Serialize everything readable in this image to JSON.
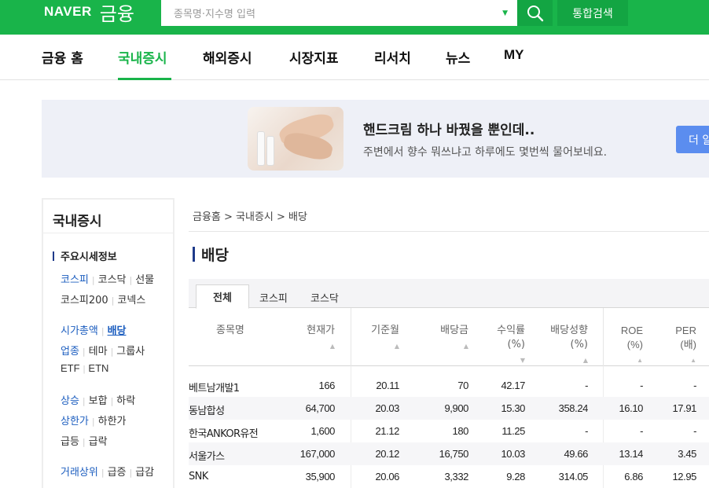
{
  "header": {
    "logo_naver": "NAVER",
    "logo_finance": "금융",
    "search_placeholder": "종목명·지수명 입력",
    "search_icon": "search-icon",
    "integrated_search": "통합검색",
    "brand_color": "#19b44a"
  },
  "nav": {
    "items": [
      "금융 홈",
      "국내증시",
      "해외증시",
      "시장지표",
      "리서치",
      "뉴스",
      "MY"
    ],
    "active": "국내증시"
  },
  "banner": {
    "title": "핸드크림 하나 바꿨을 뿐인데..",
    "desc": "주변에서 향수 뭐쓰냐고 하루에도 몇번씩 물어보네요.",
    "button": "더 알"
  },
  "sidebar": {
    "title": "국내증시",
    "section": "주요시세정보",
    "rows": [
      [
        "코스피",
        "코스닥",
        "선물"
      ],
      [
        "코스피200",
        "코넥스"
      ],
      [
        "시가총액",
        "배당"
      ],
      [
        "업종",
        "테마",
        "그룹사"
      ],
      [
        "ETF",
        "ETN"
      ],
      [
        "상승",
        "보합",
        "하락"
      ],
      [
        "상한가",
        "하한가"
      ],
      [
        "급등",
        "급락"
      ],
      [
        "거래상위",
        "급증",
        "급감"
      ]
    ]
  },
  "breadcrumb": "금융홈 > 국내증시 > 배당",
  "page_title": "배당",
  "tabs": [
    "전체",
    "코스피",
    "코스닥"
  ],
  "table": {
    "headers": [
      "종목명",
      "현재가",
      "기준월",
      "배당금",
      "수익률\n(%)",
      "배당성향\n(%)",
      "ROE\n(%)",
      "PER\n(배)"
    ],
    "rows": [
      [
        "베트남개발1",
        "166",
        "20.11",
        "70",
        "42.17",
        "-",
        "-",
        "-"
      ],
      [
        "동남합성",
        "64,700",
        "20.03",
        "9,900",
        "15.30",
        "358.24",
        "16.10",
        "17.91"
      ],
      [
        "한국ANKOR유전",
        "1,600",
        "21.12",
        "180",
        "11.25",
        "-",
        "-",
        "-"
      ],
      [
        "서울가스",
        "167,000",
        "20.12",
        "16,750",
        "10.03",
        "49.66",
        "13.14",
        "3.45"
      ],
      [
        "SNK",
        "35,900",
        "20.06",
        "3,332",
        "9.28",
        "314.05",
        "6.86",
        "12.95"
      ]
    ]
  }
}
